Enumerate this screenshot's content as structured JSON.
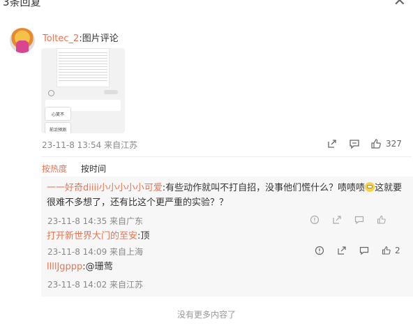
{
  "header": {
    "title": "3条回复",
    "close_label": "✕"
  },
  "comment": {
    "user_name": "Toltec_2",
    "type_text": ":图片评论",
    "thumb_buttons": [
      "心笑不",
      "前沿预测"
    ],
    "time": "23-11-8 13:54",
    "location": "来自江苏",
    "like_count": "327"
  },
  "sort": {
    "hot": "按热度",
    "time": "按时间"
  },
  "replies": [
    {
      "nick": "一一好奇diiii小小小小小可爱",
      "text_a": ":有些动作就叫不打自招，没事他们慌什么？啧啧啧",
      "text_b": "这就要很难不多想了，还有比这个更严重的实验？？",
      "time": "23-11-8 14:35 来自广东"
    },
    {
      "nick": "打开新世界大门的至安",
      "text_a": ":顶",
      "time": "23-11-8 14:09 来自上海",
      "like_count": "2"
    },
    {
      "nick": "llllJgppp",
      "text_a": ":@珊莺",
      "time": "23-11-8 14:02 来自江苏"
    }
  ],
  "footer_text": "没有更多内容了"
}
